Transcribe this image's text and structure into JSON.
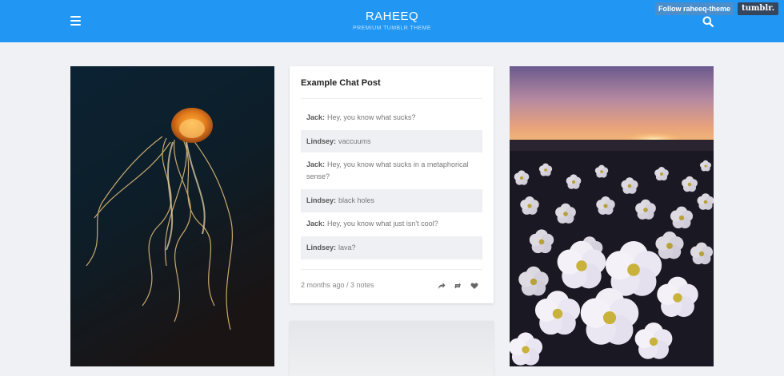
{
  "header": {
    "title": "RAHEEQ",
    "subtitle": "PREMIUM TUMBLR THEME",
    "menu_icon": "hamburger-menu-icon",
    "search_icon": "search-icon"
  },
  "tumblr_controls": {
    "follow_label": "Follow raheeq-theme",
    "logo_label": "tumblr."
  },
  "posts": {
    "chat": {
      "title": "Example Chat Post",
      "lines": [
        {
          "label": "Jack:",
          "text": "Hey, you know what sucks?"
        },
        {
          "label": "Lindsey:",
          "text": "vaccuums"
        },
        {
          "label": "Jack:",
          "text": "Hey, you know what sucks in a metaphorical sense?"
        },
        {
          "label": "Lindsey:",
          "text": "black holes"
        },
        {
          "label": "Jack:",
          "text": "Hey, you know what just isn't cool?"
        },
        {
          "label": "Lindsey:",
          "text": "lava?"
        }
      ],
      "meta": "2 months ago / 3 notes",
      "actions": [
        "share-icon",
        "reblog-icon",
        "like-heart-icon"
      ]
    }
  },
  "colors": {
    "header_bg": "#2196f3",
    "page_bg": "#f0f1f5",
    "tumblr_bg": "#35465c"
  }
}
